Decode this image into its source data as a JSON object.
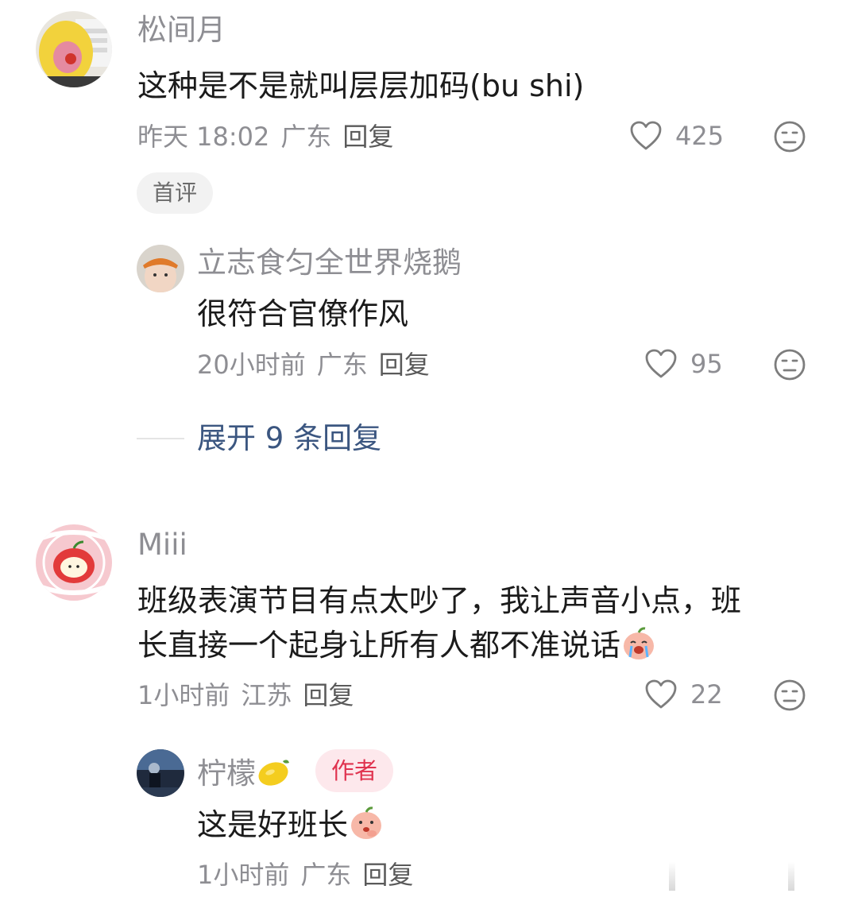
{
  "comments": [
    {
      "username": "松间月",
      "content": "这种是不是就叫层层加码(bu shi)",
      "time": "昨天 18:02",
      "location": "广东",
      "reply_label": "回复",
      "likes": "425",
      "badge": "首评",
      "replies": [
        {
          "username": "立志食匀全世界烧鹅",
          "content": "很符合官僚作风",
          "time": "20小时前",
          "location": "广东",
          "reply_label": "回复",
          "likes": "95"
        }
      ],
      "expand_label": "展开 9 条回复"
    },
    {
      "username": "Miii",
      "content_line1": "班级表演节目有点太吵了，我让声音小点，班",
      "content_line2": "长直接一个起身让所有人都不准说话",
      "time": "1小时前",
      "location": "江苏",
      "reply_label": "回复",
      "likes": "22",
      "replies": [
        {
          "username": "柠檬",
          "username_emoji": "lemon-emoji",
          "author_badge": "作者",
          "content": "这是好班长",
          "time": "1小时前",
          "location": "广东",
          "reply_label": "回复"
        }
      ]
    }
  ],
  "icons": {
    "like": "heart-outline-icon",
    "dislike": "meh-face-icon",
    "crying_emoji": "crying-peach-emoji",
    "thinking_emoji": "thinking-peach-emoji"
  },
  "colors": {
    "username": "#8e8e93",
    "content": "#1b1b1b",
    "expand_link": "#3b5680",
    "author_badge_bg": "#fde8ec",
    "author_badge_text": "#e0334f"
  }
}
